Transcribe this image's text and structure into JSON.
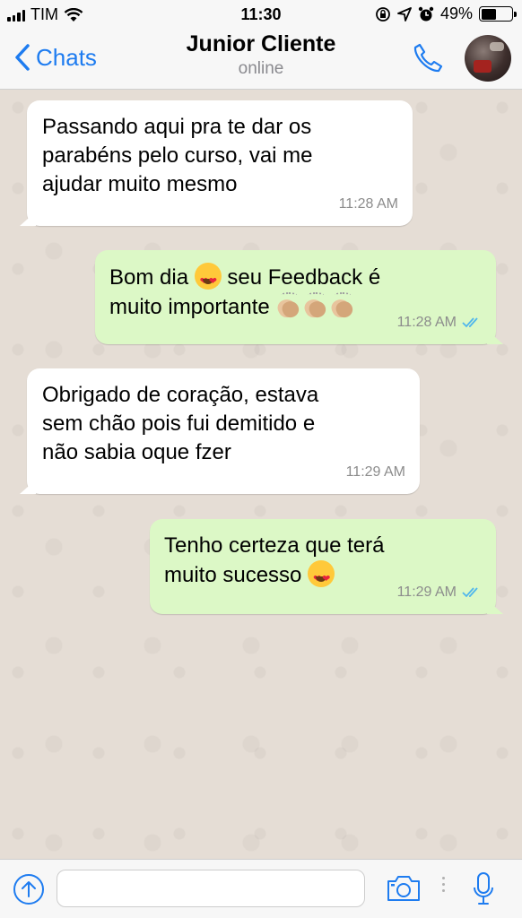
{
  "status_bar": {
    "carrier": "TIM",
    "time": "11:30",
    "battery": "49%",
    "battery_level": 0.49
  },
  "header": {
    "back_label": "Chats",
    "contact_name": "Junior Cliente",
    "contact_status": "online"
  },
  "messages": [
    {
      "direction": "incoming",
      "text": "Passando aqui pra te dar os\nparabéns pelo curso, vai me\najudar muito mesmo",
      "time": "11:28 AM"
    },
    {
      "direction": "outgoing",
      "text_parts": [
        "Bom dia ",
        " seu Feedback é\nmuito importante "
      ],
      "emojis": [
        "heart-eyes-emoji",
        "clapping-hands-emoji"
      ],
      "time": "11:28 AM",
      "status": "read"
    },
    {
      "direction": "incoming",
      "text": "Obrigado de coração, estava\nsem chão pois fui demitido e\nnão sabia oque fzer",
      "time": "11:29 AM"
    },
    {
      "direction": "outgoing",
      "text": "Tenho certeza que terá\nmuito sucesso ",
      "emojis": [
        "heart-eyes-emoji"
      ],
      "time": "11:29 AM",
      "status": "read"
    }
  ],
  "input": {
    "value": "",
    "placeholder": ""
  },
  "colors": {
    "accent": "#1e7cf0",
    "incoming_bubble": "#ffffff",
    "outgoing_bubble": "#dcf8c6",
    "read_ticks": "#4fb6ec",
    "chat_background": "#e5ddd5"
  },
  "icons": [
    "signal-icon",
    "wifi-icon",
    "rotation-lock-icon",
    "location-icon",
    "alarm-icon",
    "battery-icon",
    "back-chevron-icon",
    "phone-icon",
    "attach-icon",
    "camera-icon",
    "more-dots-icon",
    "microphone-icon",
    "double-check-icon"
  ]
}
